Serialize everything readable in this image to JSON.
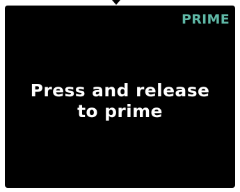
{
  "screen": {
    "mode_label": "PRIME",
    "instruction_line1": "Press and release",
    "instruction_line2": "to prime"
  },
  "colors": {
    "background": "#000000",
    "accent": "#5fb8a6",
    "text": "#ffffff"
  },
  "icons": {
    "top_indicator": "triangle-down-icon"
  }
}
